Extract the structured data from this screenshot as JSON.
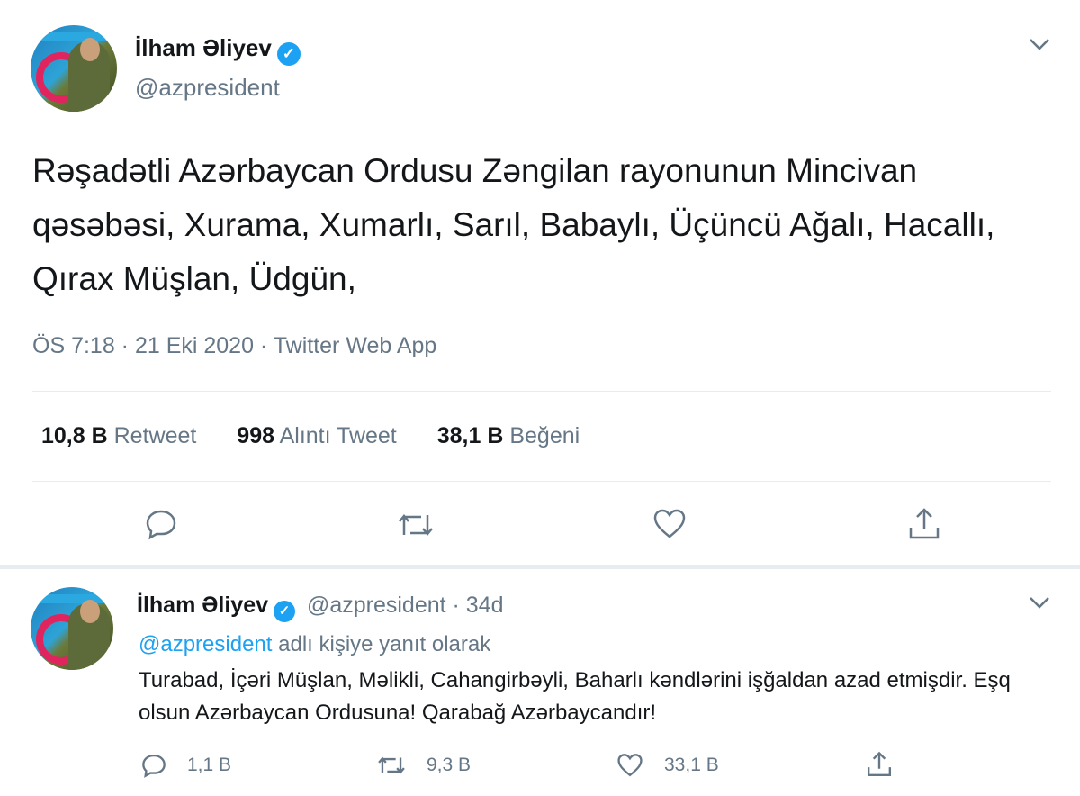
{
  "main_tweet": {
    "author_name": "İlham Əliyev",
    "handle": "@azpresident",
    "text": "Rəşadətli Azərbaycan Ordusu Zəngilan rayonunun Mincivan qəsəbəsi, Xurama, Xumarlı, Sarıl, Babaylı, Üçüncü Ağalı, Hacallı, Qırax Müşlan, Üdgün,",
    "timestamp": "ÖS 7:18 · 21 Eki 2020 · Twitter Web App",
    "stats": {
      "retweets_value": "10,8 B",
      "retweets_label": "Retweet",
      "quotes_value": "998",
      "quotes_label": "Alıntı Tweet",
      "likes_value": "38,1 B",
      "likes_label": "Beğeni"
    }
  },
  "reply_tweet": {
    "author_name": "İlham Əliyev",
    "handle_time": "@azpresident · 34d",
    "replying_link": "@azpresident",
    "replying_rest": " adlı kişiye yanıt olarak",
    "text": "Turabad, İçəri Müşlan, Məlikli, Cahangirbəyli, Baharlı kəndlərini işğaldan azad etmişdir. Eşq olsun Azərbaycan Ordusuna! Qarabağ Azərbaycandır!",
    "replies": "1,1 B",
    "retweets": "9,3 B",
    "likes": "33,1 B"
  },
  "colors": {
    "accent": "#1da1f2",
    "muted": "#657786",
    "text": "#14171a",
    "divider": "#e6ecf0"
  }
}
